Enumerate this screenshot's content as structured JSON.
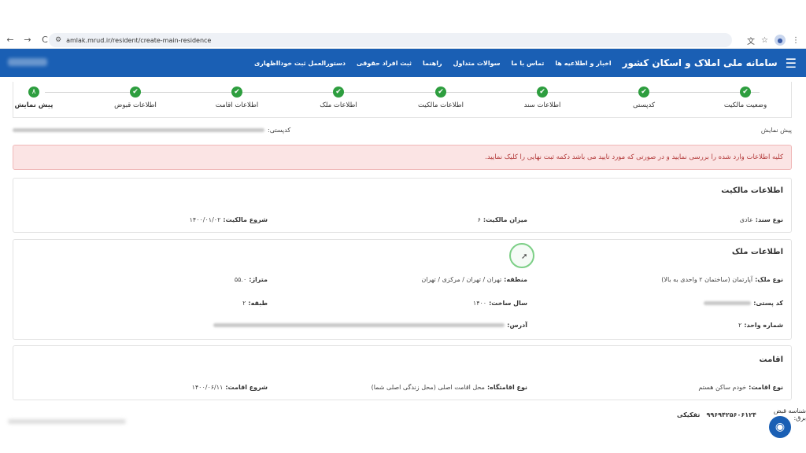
{
  "browser": {
    "url": "amlak.mrud.ir/resident/create-main-residence",
    "back_icon": "←",
    "forward_icon": "→",
    "reload_icon": "C"
  },
  "header": {
    "title": "سامانه ملی املاک و اسکان کشور",
    "menu": [
      "اخبار و اطلاعیه ها",
      "تماس با ما",
      "سوالات متداول",
      "راهنما",
      "ثبت افراد حقوقی",
      "دستورالعمل ثبت خودااظهاری"
    ]
  },
  "stepper": {
    "steps": [
      {
        "label": "وضعیت مالکیت",
        "icon": "✔"
      },
      {
        "label": "کدپستی",
        "icon": "✔"
      },
      {
        "label": "اطلاعات سند",
        "icon": "✔"
      },
      {
        "label": "اطلاعات مالکیت",
        "icon": "✔"
      },
      {
        "label": "اطلاعات ملک",
        "icon": "✔"
      },
      {
        "label": "اطلاعات اقامت",
        "icon": "✔"
      },
      {
        "label": "اطلاعات قبوض",
        "icon": "✔"
      },
      {
        "label": "پیش نمایش",
        "icon": "۸"
      }
    ]
  },
  "preview": {
    "title": "پیش نمایش",
    "postal_label": "کدپستی:"
  },
  "alert": {
    "text": "کلیه اطلاعات وارد شده را بررسی نمایید و در صورتی که مورد تایید می باشد دکمه ثبت نهایی را کلیک نمایید."
  },
  "ownership": {
    "title": "اطلاعات مالکیت",
    "doc_type_label": "نوع سند:",
    "doc_type_value": "عادی",
    "share_label": "میزان مالکیت:",
    "share_value": "۶",
    "start_label": "شروع مالکیت:",
    "start_value": "۱۴۰۰/۰۱/۰۲"
  },
  "property": {
    "title": "اطلاعات ملک",
    "type_label": "نوع ملک:",
    "type_value": "آپارتمان (ساختمان ۲ واحدی به بالا)",
    "region_label": "منطقه:",
    "region_value": "تهران / تهران / مرکزی / تهران",
    "area_label": "متراژ:",
    "area_value": "۵۵.۰",
    "postal_label": "کد پستی:",
    "year_label": "سال ساخت:",
    "year_value": "۱۴۰۰",
    "floor_label": "طبقه:",
    "floor_value": "۲",
    "unit_label": "شماره واحد:",
    "unit_value": "۲",
    "address_label": "آدرس:"
  },
  "residence": {
    "title": "اقامت",
    "type_label": "نوع اقامت:",
    "type_value": "خودم ساکن هستم",
    "place_label": "نوع اقامتگاه:",
    "place_value": "محل اقامت اصلی (محل زندگی اصلی شما)",
    "start_label": "شروع اقامت:",
    "start_value": "۱۴۰۰/۰۶/۱۱"
  },
  "bottom": {
    "bill_label": "شناسه قبض برق:",
    "bill_value": "۹۹۶۹۴۲۵۶۰۶۱۲۴",
    "type_value": "تفکیکی"
  }
}
